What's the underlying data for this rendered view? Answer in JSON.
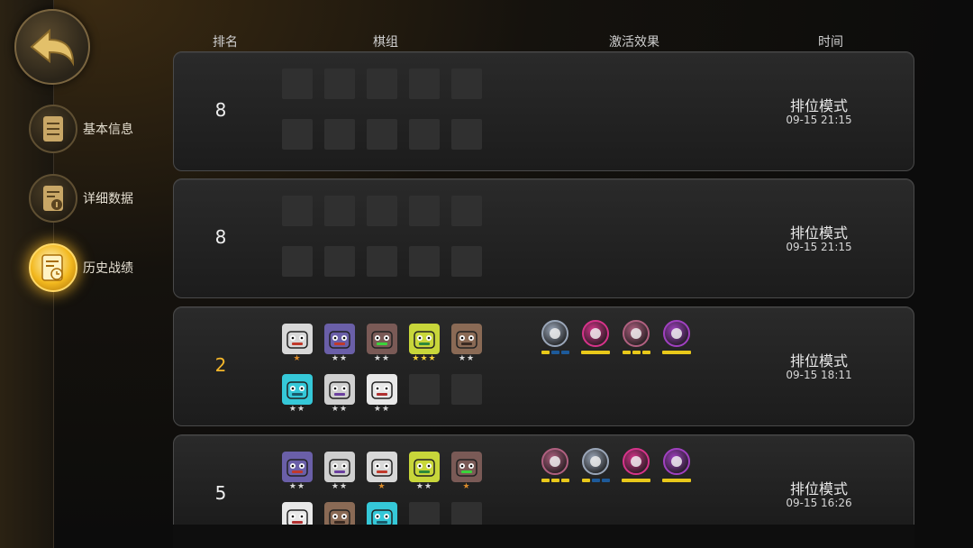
{
  "nav": {
    "back_icon": "back-arrow-icon",
    "items": [
      {
        "label": "基本信息",
        "icon": "info-scroll-icon",
        "active": false
      },
      {
        "label": "详细数据",
        "icon": "data-scroll-icon",
        "active": false
      },
      {
        "label": "历史战绩",
        "icon": "history-clock-icon",
        "active": true
      }
    ]
  },
  "headers": {
    "rank": "排名",
    "lineup": "棋组",
    "synergy": "激活效果",
    "time": "时间"
  },
  "matches": [
    {
      "rank": "8",
      "mode": "排位模式",
      "time": "09-15 21:15",
      "units": [],
      "synergies": []
    },
    {
      "rank": "8",
      "mode": "排位模式",
      "time": "09-15 21:15",
      "units": [],
      "synergies": []
    },
    {
      "rank": "2",
      "mode": "排位模式",
      "time": "09-15 18:11",
      "units": [
        {
          "stars": "★",
          "color": "#d8d8d8",
          "accent": "#c0392b"
        },
        {
          "stars": "★★",
          "color": "#6a5fa8",
          "accent": "#c0392b"
        },
        {
          "stars": "★★",
          "color": "#7a5a56",
          "accent": "#3ad43a"
        },
        {
          "stars": "★★★",
          "color": "#c8d63a",
          "accent": "#2d8a3a"
        },
        {
          "stars": "★★",
          "color": "#8a6a55",
          "accent": "#3a2a22"
        },
        {
          "stars": "★★",
          "color": "#35c8d8",
          "accent": "#1a5a6a"
        },
        {
          "stars": "★★",
          "color": "#cfcfcf",
          "accent": "#6b3fa0"
        },
        {
          "stars": "★★",
          "color": "#e8e8e8",
          "accent": "#b03030"
        }
      ],
      "synergies": [
        {
          "icon": "helmet-icon",
          "color": "#9aa6b8",
          "bars": [
            "y",
            "b",
            "b"
          ]
        },
        {
          "icon": "lightning-icon",
          "color": "#d6338a",
          "bars": [
            "Y"
          ]
        },
        {
          "icon": "knight-icon",
          "color": "#b06080",
          "bars": [
            "y",
            "y",
            "y"
          ]
        },
        {
          "icon": "demon-skull-icon",
          "color": "#a040c0",
          "bars": [
            "Y"
          ]
        }
      ]
    },
    {
      "rank": "5",
      "mode": "排位模式",
      "time": "09-15 16:26",
      "units": [
        {
          "stars": "★★",
          "color": "#6a5fa8",
          "accent": "#c0392b"
        },
        {
          "stars": "★★",
          "color": "#cfcfcf",
          "accent": "#6b3fa0"
        },
        {
          "stars": "★",
          "color": "#d8d8d8",
          "accent": "#c0392b"
        },
        {
          "stars": "★★",
          "color": "#c8d63a",
          "accent": "#2d8a3a"
        },
        {
          "stars": "★",
          "color": "#7a5a56",
          "accent": "#3ad43a"
        },
        {
          "stars": "",
          "color": "#e8e8e8",
          "accent": "#b03030"
        },
        {
          "stars": "",
          "color": "#8a6a55",
          "accent": "#3a2a22"
        },
        {
          "stars": "",
          "color": "#35c8d8",
          "accent": "#1a5a6a"
        }
      ],
      "synergies": [
        {
          "icon": "knight-icon",
          "color": "#b06080",
          "bars": [
            "y",
            "y",
            "y"
          ]
        },
        {
          "icon": "helmet-icon",
          "color": "#9aa6b8",
          "bars": [
            "y",
            "b",
            "b"
          ]
        },
        {
          "icon": "lightning-icon",
          "color": "#d6338a",
          "bars": [
            "Y"
          ]
        },
        {
          "icon": "demon-skull-icon",
          "color": "#a040c0",
          "bars": [
            "Y"
          ]
        }
      ]
    }
  ]
}
